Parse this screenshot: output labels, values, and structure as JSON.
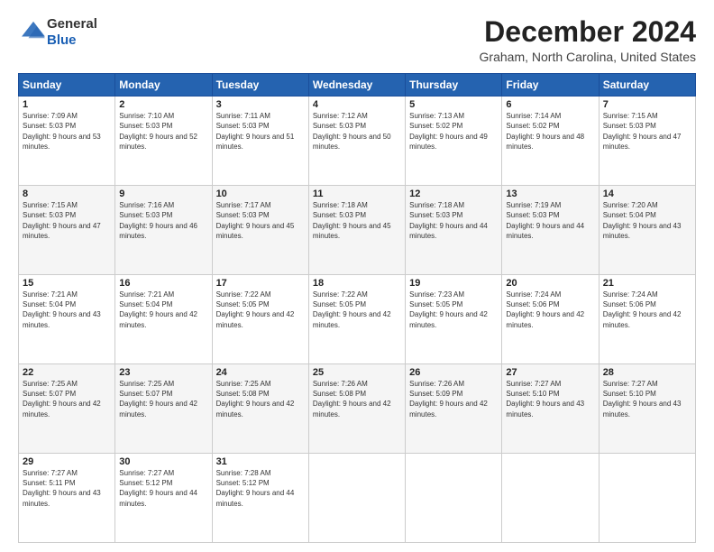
{
  "header": {
    "logo_general": "General",
    "logo_blue": "Blue",
    "month_title": "December 2024",
    "location": "Graham, North Carolina, United States"
  },
  "weekdays": [
    "Sunday",
    "Monday",
    "Tuesday",
    "Wednesday",
    "Thursday",
    "Friday",
    "Saturday"
  ],
  "weeks": [
    [
      {
        "day": "1",
        "sunrise": "7:09 AM",
        "sunset": "5:03 PM",
        "daylight": "9 hours and 53 minutes."
      },
      {
        "day": "2",
        "sunrise": "7:10 AM",
        "sunset": "5:03 PM",
        "daylight": "9 hours and 52 minutes."
      },
      {
        "day": "3",
        "sunrise": "7:11 AM",
        "sunset": "5:03 PM",
        "daylight": "9 hours and 51 minutes."
      },
      {
        "day": "4",
        "sunrise": "7:12 AM",
        "sunset": "5:03 PM",
        "daylight": "9 hours and 50 minutes."
      },
      {
        "day": "5",
        "sunrise": "7:13 AM",
        "sunset": "5:02 PM",
        "daylight": "9 hours and 49 minutes."
      },
      {
        "day": "6",
        "sunrise": "7:14 AM",
        "sunset": "5:02 PM",
        "daylight": "9 hours and 48 minutes."
      },
      {
        "day": "7",
        "sunrise": "7:15 AM",
        "sunset": "5:03 PM",
        "daylight": "9 hours and 47 minutes."
      }
    ],
    [
      {
        "day": "8",
        "sunrise": "7:15 AM",
        "sunset": "5:03 PM",
        "daylight": "9 hours and 47 minutes."
      },
      {
        "day": "9",
        "sunrise": "7:16 AM",
        "sunset": "5:03 PM",
        "daylight": "9 hours and 46 minutes."
      },
      {
        "day": "10",
        "sunrise": "7:17 AM",
        "sunset": "5:03 PM",
        "daylight": "9 hours and 45 minutes."
      },
      {
        "day": "11",
        "sunrise": "7:18 AM",
        "sunset": "5:03 PM",
        "daylight": "9 hours and 45 minutes."
      },
      {
        "day": "12",
        "sunrise": "7:18 AM",
        "sunset": "5:03 PM",
        "daylight": "9 hours and 44 minutes."
      },
      {
        "day": "13",
        "sunrise": "7:19 AM",
        "sunset": "5:03 PM",
        "daylight": "9 hours and 44 minutes."
      },
      {
        "day": "14",
        "sunrise": "7:20 AM",
        "sunset": "5:04 PM",
        "daylight": "9 hours and 43 minutes."
      }
    ],
    [
      {
        "day": "15",
        "sunrise": "7:21 AM",
        "sunset": "5:04 PM",
        "daylight": "9 hours and 43 minutes."
      },
      {
        "day": "16",
        "sunrise": "7:21 AM",
        "sunset": "5:04 PM",
        "daylight": "9 hours and 42 minutes."
      },
      {
        "day": "17",
        "sunrise": "7:22 AM",
        "sunset": "5:05 PM",
        "daylight": "9 hours and 42 minutes."
      },
      {
        "day": "18",
        "sunrise": "7:22 AM",
        "sunset": "5:05 PM",
        "daylight": "9 hours and 42 minutes."
      },
      {
        "day": "19",
        "sunrise": "7:23 AM",
        "sunset": "5:05 PM",
        "daylight": "9 hours and 42 minutes."
      },
      {
        "day": "20",
        "sunrise": "7:24 AM",
        "sunset": "5:06 PM",
        "daylight": "9 hours and 42 minutes."
      },
      {
        "day": "21",
        "sunrise": "7:24 AM",
        "sunset": "5:06 PM",
        "daylight": "9 hours and 42 minutes."
      }
    ],
    [
      {
        "day": "22",
        "sunrise": "7:25 AM",
        "sunset": "5:07 PM",
        "daylight": "9 hours and 42 minutes."
      },
      {
        "day": "23",
        "sunrise": "7:25 AM",
        "sunset": "5:07 PM",
        "daylight": "9 hours and 42 minutes."
      },
      {
        "day": "24",
        "sunrise": "7:25 AM",
        "sunset": "5:08 PM",
        "daylight": "9 hours and 42 minutes."
      },
      {
        "day": "25",
        "sunrise": "7:26 AM",
        "sunset": "5:08 PM",
        "daylight": "9 hours and 42 minutes."
      },
      {
        "day": "26",
        "sunrise": "7:26 AM",
        "sunset": "5:09 PM",
        "daylight": "9 hours and 42 minutes."
      },
      {
        "day": "27",
        "sunrise": "7:27 AM",
        "sunset": "5:10 PM",
        "daylight": "9 hours and 43 minutes."
      },
      {
        "day": "28",
        "sunrise": "7:27 AM",
        "sunset": "5:10 PM",
        "daylight": "9 hours and 43 minutes."
      }
    ],
    [
      {
        "day": "29",
        "sunrise": "7:27 AM",
        "sunset": "5:11 PM",
        "daylight": "9 hours and 43 minutes."
      },
      {
        "day": "30",
        "sunrise": "7:27 AM",
        "sunset": "5:12 PM",
        "daylight": "9 hours and 44 minutes."
      },
      {
        "day": "31",
        "sunrise": "7:28 AM",
        "sunset": "5:12 PM",
        "daylight": "9 hours and 44 minutes."
      },
      null,
      null,
      null,
      null
    ]
  ]
}
